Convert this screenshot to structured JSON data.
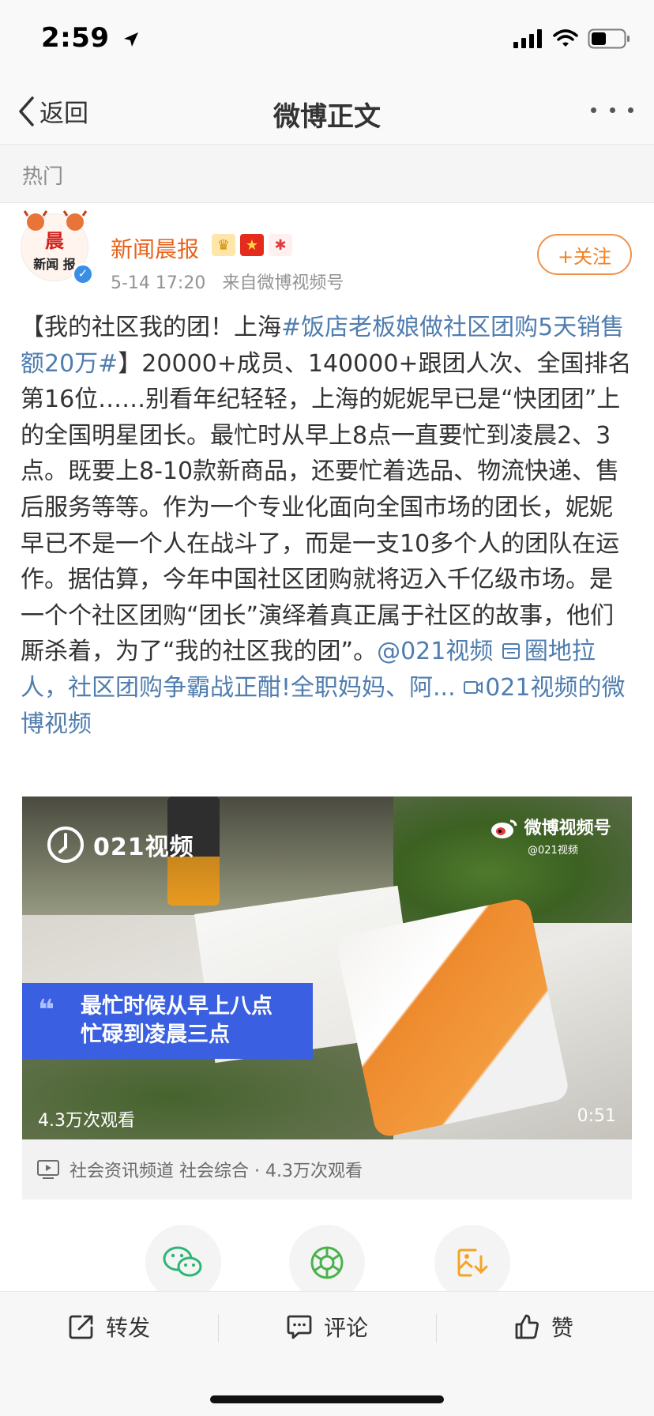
{
  "status_bar": {
    "time": "2:59"
  },
  "nav": {
    "back_label": "返回",
    "title": "微博正文"
  },
  "section": {
    "label": "热门"
  },
  "author": {
    "name": "新闻晨报",
    "avatar_text_top": "晨",
    "avatar_text_bottom": "新闻 报",
    "timestamp": "5-14 17:20",
    "source_prefix": "来自",
    "source": "微博视频号",
    "follow_label": "+关注"
  },
  "post": {
    "text_1": "【我的社区我的团！上海",
    "hashtag": "#饭店老板娘做社区团购5天销售额20万#",
    "text_2": "】20000+成员、140000+跟团人次、全国排名第16位……别看年纪轻轻，上海的妮妮早已是“快团团”上的全国明星团长。最忙时从早上8点一直要忙到凌晨2、3点。既要上8-10款新商品，还要忙着选品、物流快递、售后服务等等。作为一个专业化面向全国市场的团长，妮妮早已不是一个人在战斗了，而是一支10多个人的团队在运作。据估算，今年中国社区团购就将迈入千亿级市场。是一个个社区团购“团长”演绎着真正属于社区的故事，他们厮杀着，为了“我的社区我的团”。",
    "mention": "@021视频",
    "article_link": "圈地拉人，社区团购争霸战正酣!全职妈妈、阿...",
    "video_link": "021视频的微博视频"
  },
  "video": {
    "logo_text": "021视频",
    "watermark": "微博视频号",
    "watermark_sub": "@021视频",
    "caption_line1": "最忙时候从早上八点",
    "caption_line2": "忙碌到凌晨三点",
    "quote_mark": "66",
    "views": "4.3万次观看",
    "duration": "0:51",
    "info": "社会资讯频道 社会综合 · 4.3万次观看"
  },
  "actions": {
    "repost": "转发",
    "comment": "评论",
    "like": "赞"
  },
  "colors": {
    "link": "#507daf",
    "author": "#e8621a",
    "follow": "#f28022",
    "caption_bg": "#3a5fe0"
  },
  "icons": [
    "signal-icon",
    "wifi-icon",
    "battery-icon",
    "location-arrow-icon",
    "back-chevron-icon",
    "more-icon",
    "wechat-icon",
    "moments-icon",
    "save-image-icon",
    "repost-icon",
    "comment-icon",
    "like-icon"
  ]
}
